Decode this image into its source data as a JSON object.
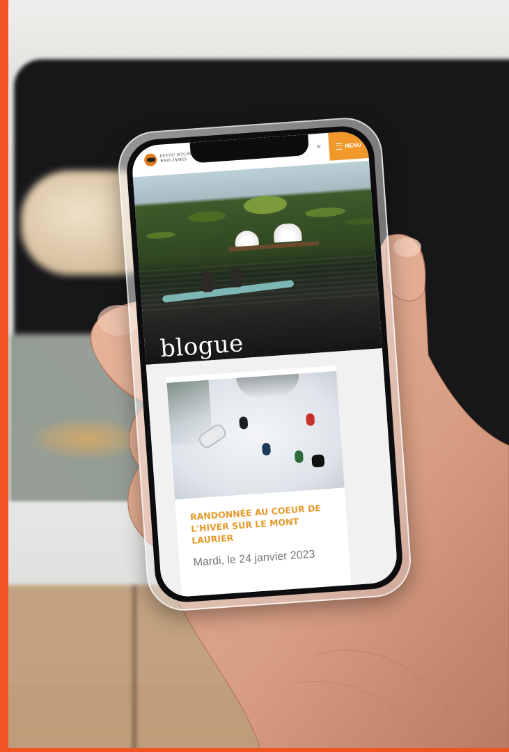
{
  "site": {
    "brand_lines": [
      "EEYOU ISTCHEE",
      "BAIE-JAMES"
    ],
    "brand_small": "",
    "menu_label": "MENU",
    "header_extra": "N"
  },
  "hero": {
    "title": "blogue"
  },
  "posts": [
    {
      "title": "RANDONNÉE AU COEUR DE L'HIVER SUR LE MONT LAURIER",
      "date": "Mardi, le 24 janvier 2023"
    }
  ],
  "colors": {
    "accent": "#f0982a",
    "title_orange": "#e39a2b",
    "frame_orange": "#f05422"
  },
  "icons": {
    "menu": "hamburger-icon",
    "logo": "brand-logo-icon"
  }
}
